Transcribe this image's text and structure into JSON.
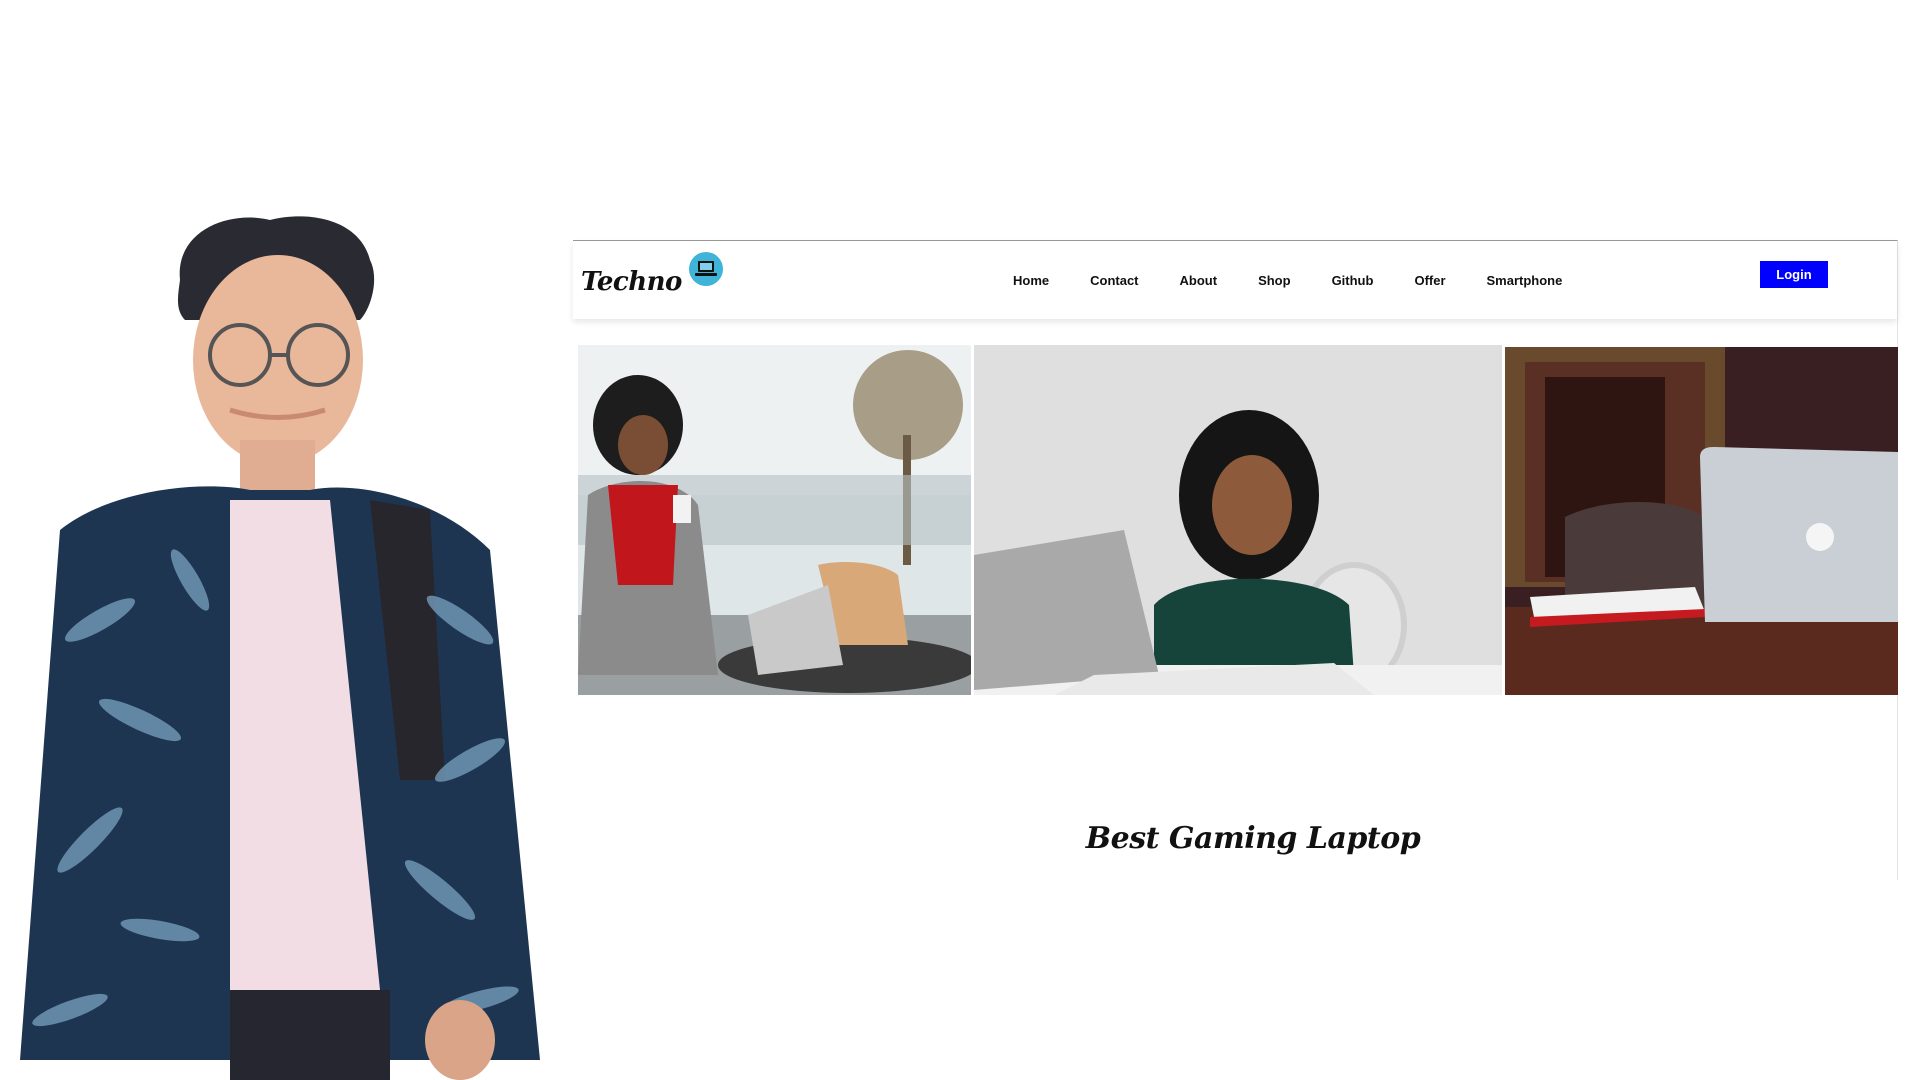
{
  "site": {
    "brand": "Techno",
    "brand_icon": "laptop-icon",
    "nav": [
      "Home",
      "Contact",
      "About",
      "Shop",
      "Github",
      "Offer",
      "Smartphone"
    ],
    "login_label": "Login",
    "section_heading": "Best Gaming Laptop"
  },
  "colors": {
    "accent": "#0000ff",
    "brand_icon_bg": "#3fb3d8"
  }
}
